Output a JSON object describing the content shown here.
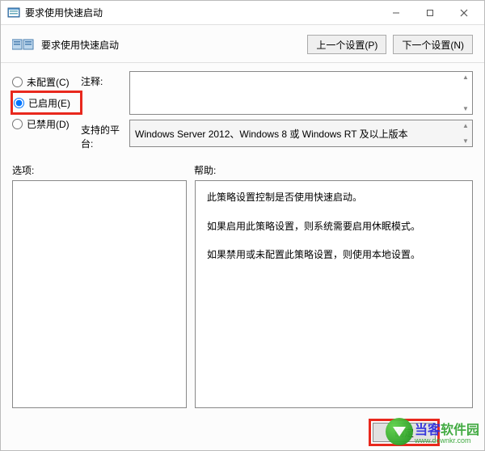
{
  "window": {
    "title": "要求使用快速启动"
  },
  "header": {
    "title": "要求使用快速启动",
    "prev_btn": "上一个设置(P)",
    "next_btn": "下一个设置(N)"
  },
  "radios": {
    "not_configured": "未配置(C)",
    "enabled": "已启用(E)",
    "disabled": "已禁用(D)",
    "selected": "enabled"
  },
  "fields": {
    "comment_label": "注释:",
    "comment_value": "",
    "platform_label": "支持的平台:",
    "platform_value": "Windows Server 2012、Windows 8 或 Windows RT 及以上版本"
  },
  "sections": {
    "options_label": "选项:",
    "help_label": "帮助:"
  },
  "help": {
    "p1": "此策略设置控制是否使用快速启动。",
    "p2": "如果启用此策略设置，则系统需要启用休眠模式。",
    "p3": "如果禁用或未配置此策略设置，则使用本地设置。"
  },
  "footer": {
    "ok": "确定"
  },
  "watermark": {
    "brand": "当客软件园",
    "url": "www.downkr.com"
  }
}
